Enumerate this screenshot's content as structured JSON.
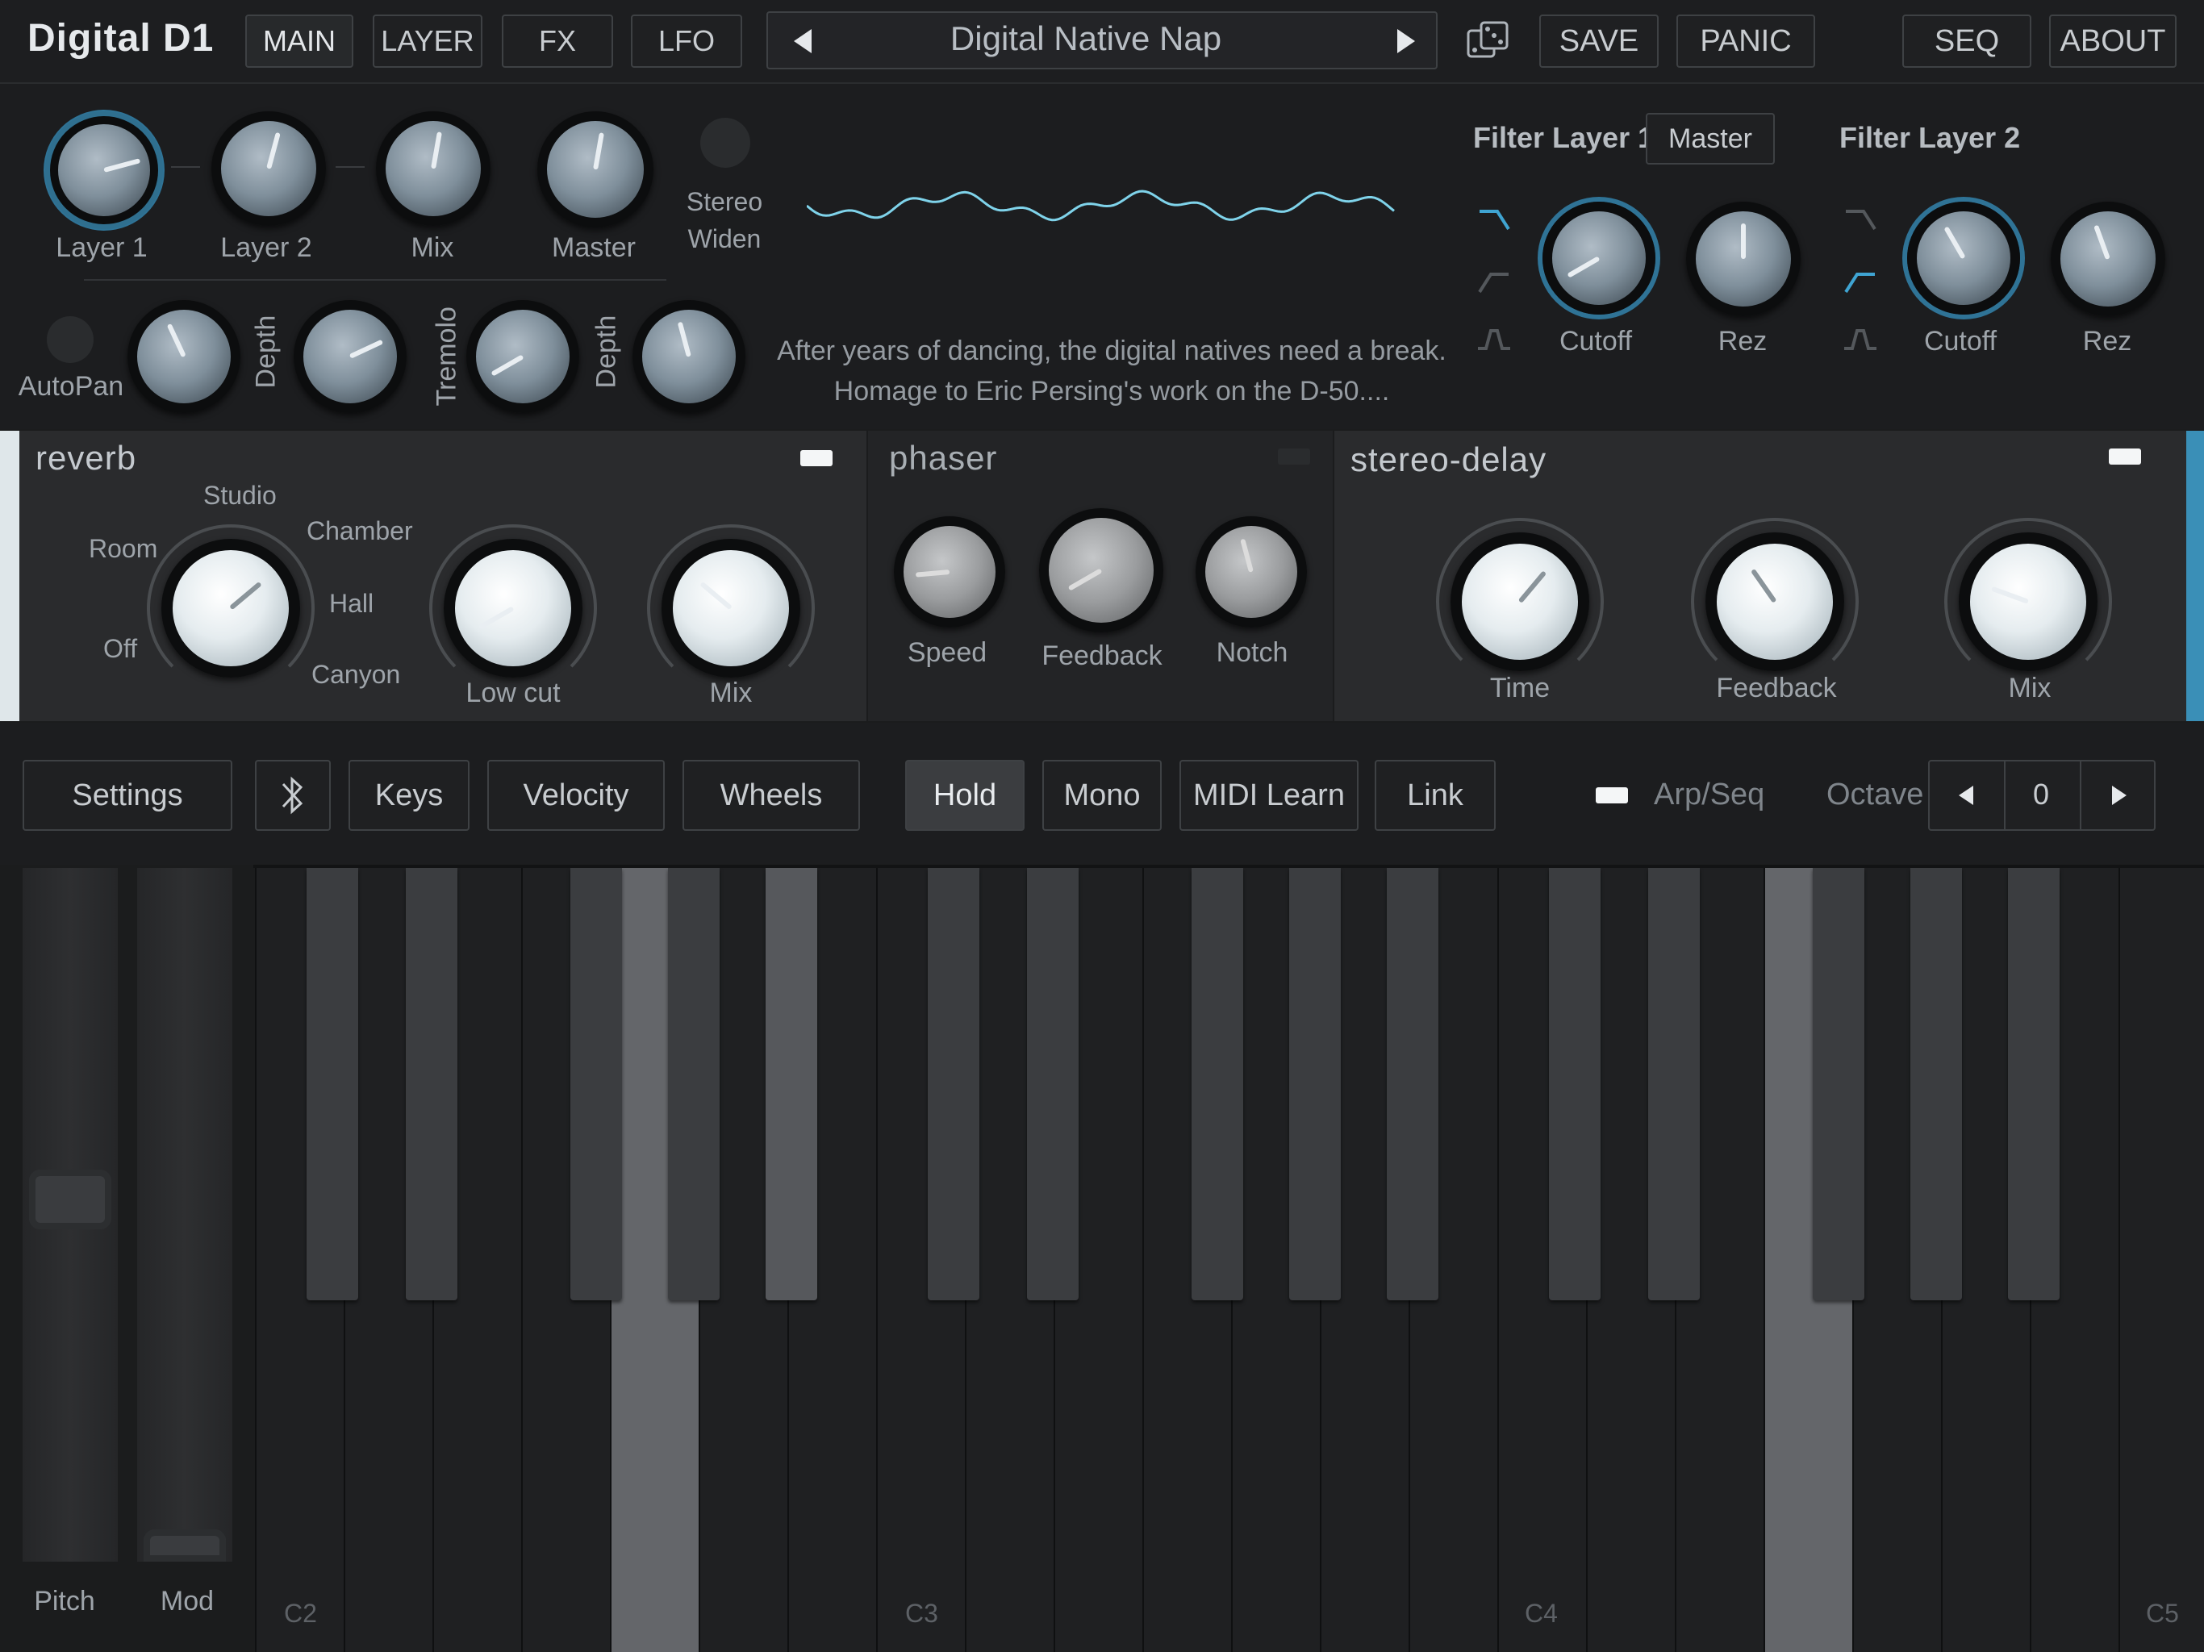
{
  "app": {
    "logo": "Digital D1"
  },
  "topbar": {
    "tabs": [
      "MAIN",
      "LAYER",
      "FX",
      "LFO"
    ],
    "preset_name": "Digital Native Nap",
    "save": "SAVE",
    "panic": "PANIC",
    "seq": "SEQ",
    "about": "ABOUT"
  },
  "main": {
    "knobs": {
      "layer1": "Layer 1",
      "layer2": "Layer 2",
      "mix": "Mix",
      "master": "Master"
    },
    "stereo_widen": [
      "Stereo",
      "Widen"
    ],
    "autopan": "AutoPan",
    "depth": "Depth",
    "tremolo": "Tremolo",
    "depth2": "Depth",
    "description": [
      "After years of dancing, the digital natives need a break.",
      "Homage to Eric Persing's work on the D-50...."
    ]
  },
  "filters": {
    "layer1_title": "Filter Layer 1",
    "master": "Master",
    "layer2_title": "Filter Layer 2",
    "cutoff": "Cutoff",
    "rez": "Rez"
  },
  "fx": {
    "reverb": {
      "title": "reverb",
      "modes": [
        "Off",
        "Room",
        "Studio",
        "Chamber",
        "Hall",
        "Canyon"
      ],
      "low_cut": "Low cut",
      "mix": "Mix",
      "enabled": true
    },
    "phaser": {
      "title": "phaser",
      "speed": "Speed",
      "feedback": "Feedback",
      "notch": "Notch",
      "enabled": false
    },
    "delay": {
      "title": "stereo-delay",
      "time": "Time",
      "feedback": "Feedback",
      "mix": "Mix",
      "enabled": true
    }
  },
  "keyboard_bar": {
    "settings": "Settings",
    "bluetooth_icon": "bluetooth-icon",
    "keys": "Keys",
    "velocity": "Velocity",
    "wheels": "Wheels",
    "hold": "Hold",
    "mono": "Mono",
    "midi_learn": "MIDI Learn",
    "link": "Link",
    "arp_seq": "Arp/Seq",
    "octave_label": "Octave",
    "octave_value": "0"
  },
  "wheels": {
    "pitch": "Pitch",
    "mod": "Mod"
  },
  "keyboard": {
    "labels": [
      "C2",
      "C3",
      "C4",
      "C5"
    ],
    "pressed_white": [
      4,
      17
    ],
    "pressed_black": [
      4
    ]
  },
  "colors": {
    "accent": "#3a8fb7",
    "background": "#1b1c1d"
  }
}
